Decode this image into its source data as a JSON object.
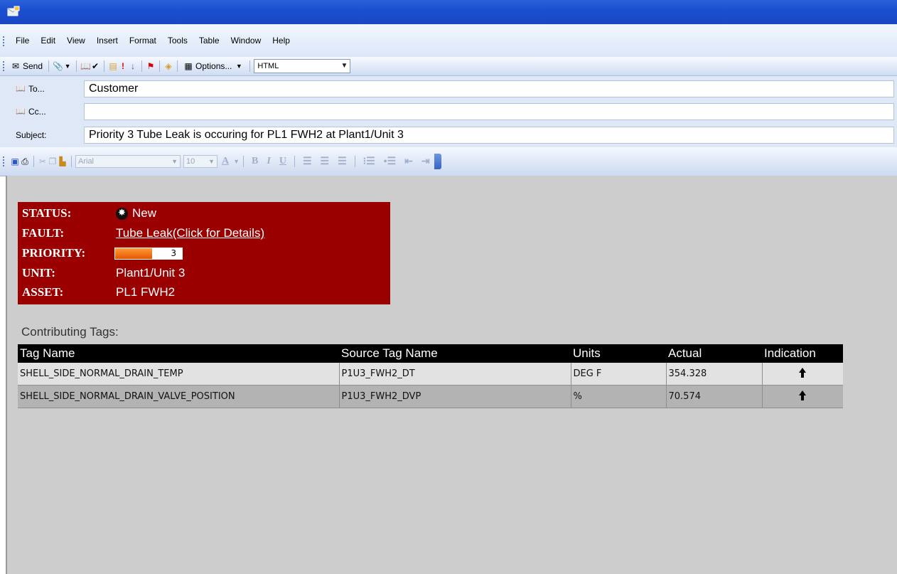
{
  "menu": [
    "File",
    "Edit",
    "View",
    "Insert",
    "Format",
    "Tools",
    "Table",
    "Window",
    "Help"
  ],
  "toolbar": {
    "send": "Send",
    "options": "Options...",
    "format": "HTML"
  },
  "header": {
    "to_label": "To...",
    "to_value": "Customer",
    "cc_label": "Cc...",
    "cc_value": "",
    "subject_label": "Subject:",
    "subject_value": "Priority 3 Tube Leak is occuring for PL1 FWH2 at Plant1/Unit 3"
  },
  "formatting": {
    "font": "Arial",
    "size": "10"
  },
  "alert": {
    "status_label": "STATUS:",
    "status_value": "New",
    "fault_label": "FAULT:",
    "fault_value": "Tube Leak(Click for Details)",
    "priority_label": "PRIORITY:",
    "priority_value": "3",
    "priority_fill": 0.55,
    "unit_label": "UNIT:",
    "unit_value": "Plant1/Unit 3",
    "asset_label": "ASSET:",
    "asset_value": "PL1 FWH2"
  },
  "contributing_title": "Contributing Tags:",
  "table": {
    "headers": [
      "Tag Name",
      "Source Tag Name",
      "Units",
      "Actual",
      "Indication"
    ],
    "rows": [
      {
        "tag": "SHELL_SIDE_NORMAL_DRAIN_TEMP",
        "source": "P1U3_FWH2_DT",
        "units": "DEG F",
        "actual": "354.328",
        "indication": "up-arrow-icon"
      },
      {
        "tag": "SHELL_SIDE_NORMAL_DRAIN_VALVE_POSITION",
        "source": "P1U3_FWH2_DVP",
        "units": "%",
        "actual": "70.574",
        "indication": "up-arrow-icon"
      }
    ]
  }
}
